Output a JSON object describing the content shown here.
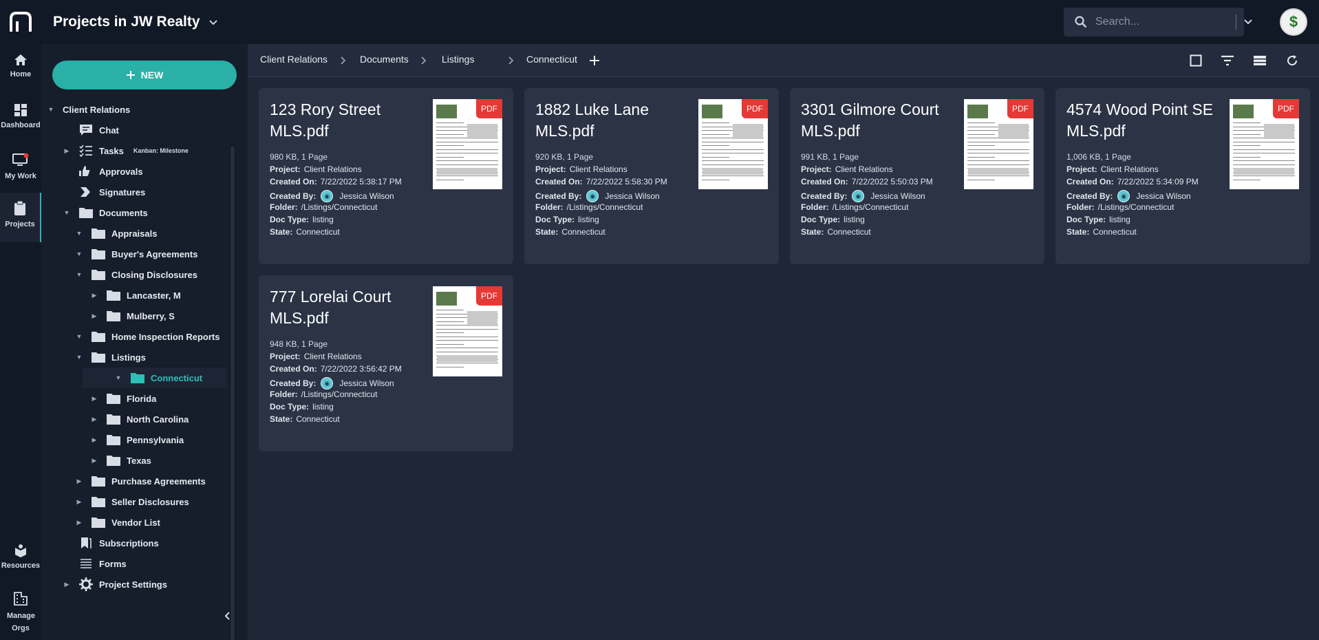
{
  "app": {
    "title": "Projects in JW Realty",
    "search_placeholder": "Search...",
    "avatar_symbol": "$"
  },
  "rail": [
    {
      "label": "Home",
      "icon": "home-icon"
    },
    {
      "label": "Dashboard",
      "icon": "dashboard-icon"
    },
    {
      "label": "My Work",
      "icon": "monitor-icon"
    },
    {
      "label": "Projects",
      "icon": "clipboard-icon"
    },
    {
      "label": "Resources",
      "icon": "book-icon"
    },
    {
      "label": "Manage Orgs",
      "icon": "building-icon"
    }
  ],
  "sidebar": {
    "new_label": "NEW",
    "tree": [
      {
        "label": "Client Relations",
        "level": 0,
        "arrow": "down",
        "icon": "none"
      },
      {
        "label": "Chat",
        "level": 1,
        "arrow": "none",
        "icon": "chat-icon"
      },
      {
        "label": "Tasks",
        "level": 1,
        "arrow": "right",
        "icon": "tasks-icon",
        "tag": "Kanban: Milestone"
      },
      {
        "label": "Approvals",
        "level": 1,
        "arrow": "none",
        "icon": "thumbs-icon"
      },
      {
        "label": "Signatures",
        "level": 1,
        "arrow": "none",
        "icon": "signature-icon"
      },
      {
        "label": "Documents",
        "level": 1,
        "arrow": "down",
        "icon": "folder-icon"
      },
      {
        "label": "Appraisals",
        "level": 2,
        "arrow": "down",
        "icon": "folder-icon"
      },
      {
        "label": "Buyer's Agreements",
        "level": 2,
        "arrow": "down",
        "icon": "folder-icon"
      },
      {
        "label": "Closing Disclosures",
        "level": 2,
        "arrow": "down",
        "icon": "folder-icon"
      },
      {
        "label": "Lancaster, M",
        "level": 3,
        "arrow": "right",
        "icon": "folder-icon"
      },
      {
        "label": "Mulberry, S",
        "level": 3,
        "arrow": "right",
        "icon": "folder-icon"
      },
      {
        "label": "Home Inspection Reports",
        "level": 2,
        "arrow": "down",
        "icon": "folder-icon"
      },
      {
        "label": "Listings",
        "level": 2,
        "arrow": "down",
        "icon": "folder-icon"
      },
      {
        "label": "Connecticut",
        "level": 3,
        "arrow": "down",
        "icon": "folder-icon",
        "selected": true
      },
      {
        "label": "Florida",
        "level": 3,
        "arrow": "right",
        "icon": "folder-icon"
      },
      {
        "label": "North Carolina",
        "level": 3,
        "arrow": "right",
        "icon": "folder-icon"
      },
      {
        "label": "Pennsylvania",
        "level": 3,
        "arrow": "right",
        "icon": "folder-icon"
      },
      {
        "label": "Texas",
        "level": 3,
        "arrow": "right",
        "icon": "folder-icon"
      },
      {
        "label": "Purchase Agreements",
        "level": 2,
        "arrow": "right",
        "icon": "folder-icon"
      },
      {
        "label": "Seller Disclosures",
        "level": 2,
        "arrow": "right",
        "icon": "folder-icon"
      },
      {
        "label": "Vendor List",
        "level": 2,
        "arrow": "right",
        "icon": "folder-icon"
      },
      {
        "label": "Subscriptions",
        "level": 1,
        "arrow": "none",
        "icon": "bookmark-icon"
      },
      {
        "label": "Forms",
        "level": 1,
        "arrow": "none",
        "icon": "list-icon"
      },
      {
        "label": "Project Settings",
        "level": 1,
        "arrow": "right",
        "icon": "gear-icon"
      }
    ]
  },
  "breadcrumb": [
    "Client Relations",
    "Documents",
    "Listings",
    "Connecticut"
  ],
  "card_labels": {
    "project": "Project:",
    "created_on": "Created On:",
    "created_by": "Created By:",
    "folder": "Folder:",
    "doc_type": "Doc Type:",
    "state": "State:",
    "badge": "PDF"
  },
  "cards": [
    {
      "title": "123 Rory Street MLS.pdf",
      "meta": "980 KB, 1 Page",
      "project": "Client Relations",
      "created_on": "7/22/2022 5:38:17 PM",
      "created_by": "Jessica Wilson",
      "folder": "/Listings/Connecticut",
      "doc_type": "listing",
      "state": "Connecticut"
    },
    {
      "title": "1882 Luke Lane MLS.pdf",
      "meta": "920 KB, 1 Page",
      "project": "Client Relations",
      "created_on": "7/22/2022 5:58:30 PM",
      "created_by": "Jessica Wilson",
      "folder": "/Listings/Connecticut",
      "doc_type": "listing",
      "state": "Connecticut"
    },
    {
      "title": "3301 Gilmore Court MLS.pdf",
      "meta": "991 KB, 1 Page",
      "project": "Client Relations",
      "created_on": "7/22/2022 5:50:03 PM",
      "created_by": "Jessica Wilson",
      "folder": "/Listings/Connecticut",
      "doc_type": "listing",
      "state": "Connecticut"
    },
    {
      "title": "4574 Wood Point SE MLS.pdf",
      "meta": "1,006 KB, 1 Page",
      "project": "Client Relations",
      "created_on": "7/22/2022 5:34:09 PM",
      "created_by": "Jessica Wilson",
      "folder": "/Listings/Connecticut",
      "doc_type": "listing",
      "state": "Connecticut"
    },
    {
      "title": "777 Lorelai Court MLS.pdf",
      "meta": "948 KB, 1 Page",
      "project": "Client Relations",
      "created_on": "7/22/2022 3:56:42 PM",
      "created_by": "Jessica Wilson",
      "folder": "/Listings/Connecticut",
      "doc_type": "listing",
      "state": "Connecticut"
    }
  ],
  "colors": {
    "accent": "#2ab0a6",
    "pdf_badge": "#e53935",
    "card": "#2b3345"
  }
}
